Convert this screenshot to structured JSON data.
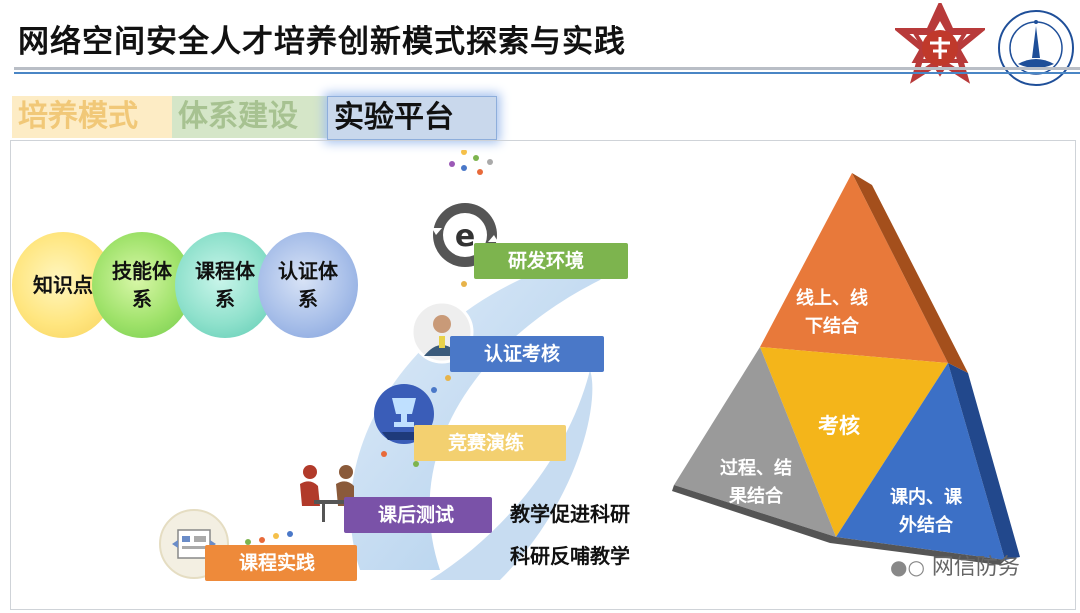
{
  "title": "网络空间安全人才培养创新模式探索与实践",
  "tabs": [
    "培养模式",
    "体系建设",
    "实验平台"
  ],
  "circles": [
    {
      "line1": "知识点",
      "line2": ""
    },
    {
      "line1": "技能体",
      "line2": "系"
    },
    {
      "line1": "课程体",
      "line2": "系"
    },
    {
      "line1": "认证体",
      "line2": "系"
    }
  ],
  "steps": [
    "研发环境",
    "认证考核",
    "竞赛演练",
    "课后测试",
    "课程实践"
  ],
  "notes": [
    "教学促进科研",
    "科研反哺教学"
  ],
  "pyramid": {
    "top": {
      "line1": "线上、线",
      "line2": "下结合"
    },
    "center": "考核",
    "left": {
      "line1": "过程、结",
      "line2": "果结合"
    },
    "right": {
      "line1": "课内、课",
      "line2": "外结合"
    }
  },
  "watermark": "网信防务",
  "colors": {
    "accent_blue": "#4a86c5",
    "green": "#7db44e",
    "blue": "#4a78c8",
    "yellow": "#f3d070",
    "purple": "#7a52a8",
    "orange": "#ee8a3a"
  }
}
